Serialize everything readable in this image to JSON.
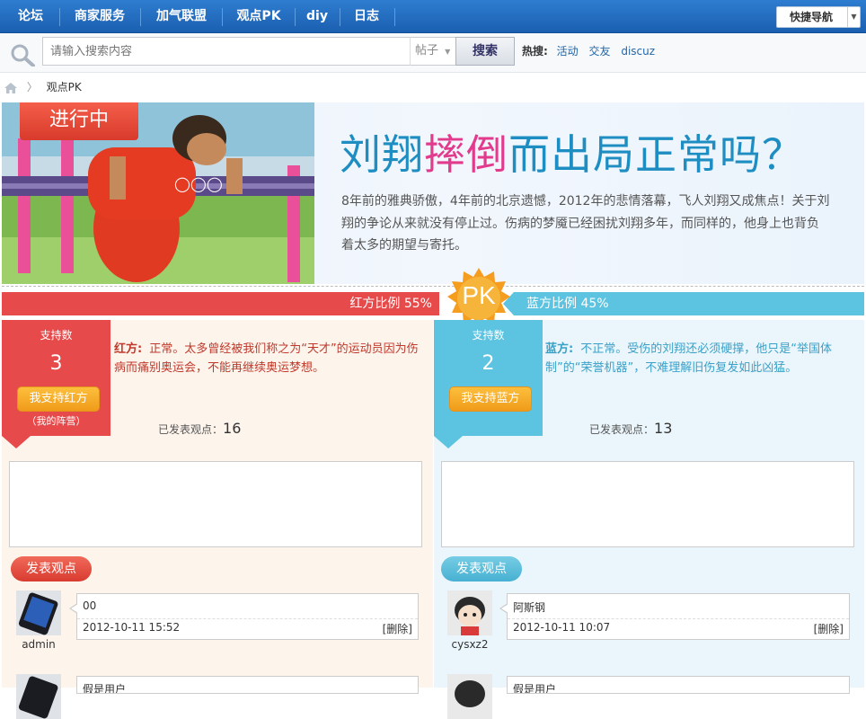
{
  "nav": {
    "items": [
      "论坛",
      "商家服务",
      "加气联盟",
      "观点PK",
      "diy",
      "日志"
    ],
    "quick_nav": "快捷导航"
  },
  "search": {
    "placeholder": "请输入搜索内容",
    "type": "帖子",
    "button": "搜索",
    "hot_label": "热搜:",
    "hot_links": [
      "活动",
      "交友",
      "discuz"
    ]
  },
  "breadcrumb": {
    "current": "观点PK"
  },
  "banner": {
    "status": "进行中",
    "title_a": "刘翔",
    "title_b": "摔倒",
    "title_c": "而出局正常吗？",
    "description": "8年前的雅典骄傲，4年前的北京遗憾，2012年的悲情落幕，飞人刘翔又成焦点！关于刘翔的争论从来就没有停止过。伤病的梦魇已经困扰刘翔多年，而同样的，他身上也背负着太多的期望与寄托。"
  },
  "ratio": {
    "red_label": "红方比例 55%",
    "blue_label": "蓝方比例 45%",
    "red_share": 55,
    "blue_share": 45,
    "pk": "PK"
  },
  "red": {
    "support_label": "支持数",
    "support_count": "3",
    "support_button": "我支持红方",
    "camp": "（我的阵营）",
    "side": "红方:",
    "view": "正常。太多曾经被我们称之为“天才”的运动员因为伤病而痛别奥运会，不能再继续奥运梦想。",
    "posted_label": "已发表观点：",
    "posted_count": "16",
    "post_button": "发表观点",
    "comments": [
      {
        "user": "admin",
        "content": "00",
        "time": "2012-10-11 15:52",
        "delete": "[删除]"
      }
    ],
    "next_preview": "假是用户"
  },
  "blue": {
    "support_label": "支持数",
    "support_count": "2",
    "support_button": "我支持蓝方",
    "side": "蓝方:",
    "view": "不正常。受伤的刘翔还必须硬撑，他只是“举国体制”的“荣誉机器”，不难理解旧伤复发如此凶猛。",
    "posted_label": "已发表观点：",
    "posted_count": "13",
    "post_button": "发表观点",
    "comments": [
      {
        "user": "cysxz2",
        "content": "阿斯钢",
        "time": "2012-10-11 10:07",
        "delete": "[删除]"
      }
    ],
    "next_preview": "假是用户"
  },
  "colors": {
    "red": "#e64a4a",
    "blue": "#5cc3e0",
    "nav": "#1f65b5",
    "button_orange": "#f5a623"
  }
}
